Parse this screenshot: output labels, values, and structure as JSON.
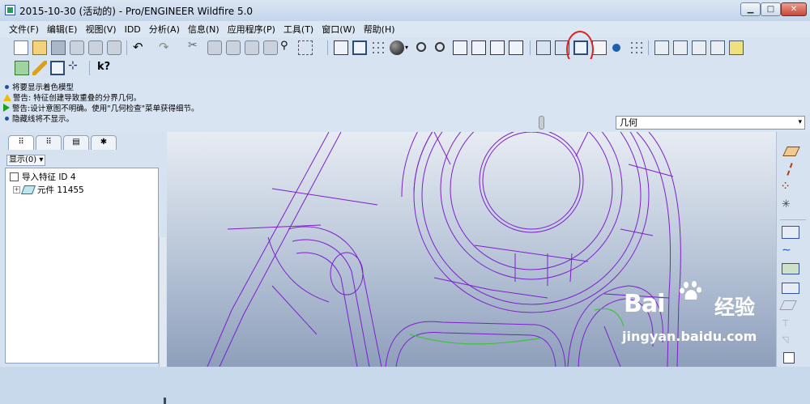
{
  "window": {
    "title": "2015-10-30 (活动的) - Pro/ENGINEER Wildfire 5.0"
  },
  "window_controls": {
    "minimize": "▁",
    "maximize": "□",
    "close": "✕"
  },
  "menu": [
    {
      "label": "文件(F)"
    },
    {
      "label": "编辑(E)"
    },
    {
      "label": "视图(V)"
    },
    {
      "label": "IDD"
    },
    {
      "label": "分析(A)"
    },
    {
      "label": "信息(N)"
    },
    {
      "label": "应用程序(P)"
    },
    {
      "label": "工具(T)"
    },
    {
      "label": "窗口(W)"
    },
    {
      "label": "帮助(H)"
    }
  ],
  "toolbar": {
    "help_glyph": "k?",
    "highlight_color": "#e02020"
  },
  "messages": [
    {
      "type": "info",
      "text": "将要显示着色模型"
    },
    {
      "type": "warning",
      "text": "警告: 特征创建导致重叠的分界几何。"
    },
    {
      "type": "warning-arrow",
      "text": "警告:设计意图不明确。使用\"几何检查\"菜单获得细节。"
    },
    {
      "type": "info",
      "text": "隐藏线将不显示。"
    }
  ],
  "filter": {
    "value": "几何",
    "arrow": "▾"
  },
  "model_tree": {
    "display_menu": "显示(0) ▾",
    "items": [
      {
        "label": "导入特征 ID 4",
        "expand": ""
      },
      {
        "label": "元件 11455",
        "expand": "+"
      }
    ]
  },
  "graphics": {
    "wire_color": "#7d1fcf",
    "accent_color": "#3ec23e"
  },
  "watermark": {
    "brand": "Bai",
    "cn": "经验",
    "url": "jingyan.baidu.com"
  }
}
